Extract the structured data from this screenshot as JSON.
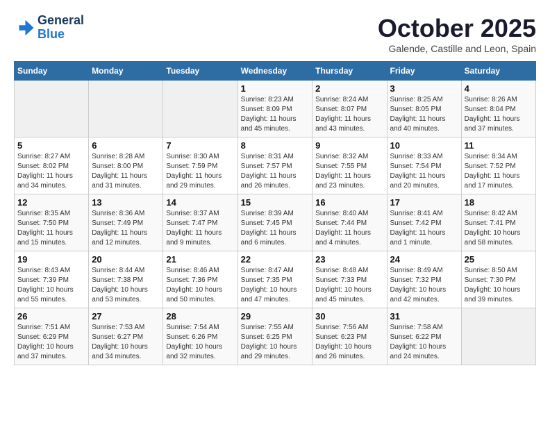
{
  "header": {
    "logo_line1": "General",
    "logo_line2": "Blue",
    "month": "October 2025",
    "location": "Galende, Castille and Leon, Spain"
  },
  "days_of_week": [
    "Sunday",
    "Monday",
    "Tuesday",
    "Wednesday",
    "Thursday",
    "Friday",
    "Saturday"
  ],
  "weeks": [
    [
      {
        "day": "",
        "info": ""
      },
      {
        "day": "",
        "info": ""
      },
      {
        "day": "",
        "info": ""
      },
      {
        "day": "1",
        "info": "Sunrise: 8:23 AM\nSunset: 8:09 PM\nDaylight: 11 hours\nand 45 minutes."
      },
      {
        "day": "2",
        "info": "Sunrise: 8:24 AM\nSunset: 8:07 PM\nDaylight: 11 hours\nand 43 minutes."
      },
      {
        "day": "3",
        "info": "Sunrise: 8:25 AM\nSunset: 8:05 PM\nDaylight: 11 hours\nand 40 minutes."
      },
      {
        "day": "4",
        "info": "Sunrise: 8:26 AM\nSunset: 8:04 PM\nDaylight: 11 hours\nand 37 minutes."
      }
    ],
    [
      {
        "day": "5",
        "info": "Sunrise: 8:27 AM\nSunset: 8:02 PM\nDaylight: 11 hours\nand 34 minutes."
      },
      {
        "day": "6",
        "info": "Sunrise: 8:28 AM\nSunset: 8:00 PM\nDaylight: 11 hours\nand 31 minutes."
      },
      {
        "day": "7",
        "info": "Sunrise: 8:30 AM\nSunset: 7:59 PM\nDaylight: 11 hours\nand 29 minutes."
      },
      {
        "day": "8",
        "info": "Sunrise: 8:31 AM\nSunset: 7:57 PM\nDaylight: 11 hours\nand 26 minutes."
      },
      {
        "day": "9",
        "info": "Sunrise: 8:32 AM\nSunset: 7:55 PM\nDaylight: 11 hours\nand 23 minutes."
      },
      {
        "day": "10",
        "info": "Sunrise: 8:33 AM\nSunset: 7:54 PM\nDaylight: 11 hours\nand 20 minutes."
      },
      {
        "day": "11",
        "info": "Sunrise: 8:34 AM\nSunset: 7:52 PM\nDaylight: 11 hours\nand 17 minutes."
      }
    ],
    [
      {
        "day": "12",
        "info": "Sunrise: 8:35 AM\nSunset: 7:50 PM\nDaylight: 11 hours\nand 15 minutes."
      },
      {
        "day": "13",
        "info": "Sunrise: 8:36 AM\nSunset: 7:49 PM\nDaylight: 11 hours\nand 12 minutes."
      },
      {
        "day": "14",
        "info": "Sunrise: 8:37 AM\nSunset: 7:47 PM\nDaylight: 11 hours\nand 9 minutes."
      },
      {
        "day": "15",
        "info": "Sunrise: 8:39 AM\nSunset: 7:45 PM\nDaylight: 11 hours\nand 6 minutes."
      },
      {
        "day": "16",
        "info": "Sunrise: 8:40 AM\nSunset: 7:44 PM\nDaylight: 11 hours\nand 4 minutes."
      },
      {
        "day": "17",
        "info": "Sunrise: 8:41 AM\nSunset: 7:42 PM\nDaylight: 11 hours\nand 1 minute."
      },
      {
        "day": "18",
        "info": "Sunrise: 8:42 AM\nSunset: 7:41 PM\nDaylight: 10 hours\nand 58 minutes."
      }
    ],
    [
      {
        "day": "19",
        "info": "Sunrise: 8:43 AM\nSunset: 7:39 PM\nDaylight: 10 hours\nand 55 minutes."
      },
      {
        "day": "20",
        "info": "Sunrise: 8:44 AM\nSunset: 7:38 PM\nDaylight: 10 hours\nand 53 minutes."
      },
      {
        "day": "21",
        "info": "Sunrise: 8:46 AM\nSunset: 7:36 PM\nDaylight: 10 hours\nand 50 minutes."
      },
      {
        "day": "22",
        "info": "Sunrise: 8:47 AM\nSunset: 7:35 PM\nDaylight: 10 hours\nand 47 minutes."
      },
      {
        "day": "23",
        "info": "Sunrise: 8:48 AM\nSunset: 7:33 PM\nDaylight: 10 hours\nand 45 minutes."
      },
      {
        "day": "24",
        "info": "Sunrise: 8:49 AM\nSunset: 7:32 PM\nDaylight: 10 hours\nand 42 minutes."
      },
      {
        "day": "25",
        "info": "Sunrise: 8:50 AM\nSunset: 7:30 PM\nDaylight: 10 hours\nand 39 minutes."
      }
    ],
    [
      {
        "day": "26",
        "info": "Sunrise: 7:51 AM\nSunset: 6:29 PM\nDaylight: 10 hours\nand 37 minutes."
      },
      {
        "day": "27",
        "info": "Sunrise: 7:53 AM\nSunset: 6:27 PM\nDaylight: 10 hours\nand 34 minutes."
      },
      {
        "day": "28",
        "info": "Sunrise: 7:54 AM\nSunset: 6:26 PM\nDaylight: 10 hours\nand 32 minutes."
      },
      {
        "day": "29",
        "info": "Sunrise: 7:55 AM\nSunset: 6:25 PM\nDaylight: 10 hours\nand 29 minutes."
      },
      {
        "day": "30",
        "info": "Sunrise: 7:56 AM\nSunset: 6:23 PM\nDaylight: 10 hours\nand 26 minutes."
      },
      {
        "day": "31",
        "info": "Sunrise: 7:58 AM\nSunset: 6:22 PM\nDaylight: 10 hours\nand 24 minutes."
      },
      {
        "day": "",
        "info": ""
      }
    ]
  ]
}
